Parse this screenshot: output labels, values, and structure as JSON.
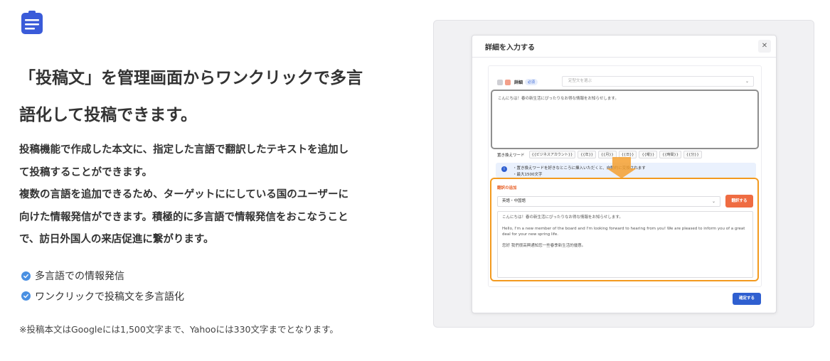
{
  "heading": {
    "line1": "「投稿文」を管理画面からワンクリックで多言",
    "line2": "語化して投稿できます。"
  },
  "description": {
    "line1": "投稿機能で作成した本文に、指定した言語で翻訳したテキストを追加し",
    "line2": "て投稿することができます。",
    "line3": "複数の言語を追加できるため、ターゲットににしている国のユーザーに",
    "line4": "向けた情報発信ができます。積極的に多言語で情報発信をおこなうこと",
    "line5": "で、訪日外国人の来店促進に繋がります。"
  },
  "bullets": [
    "多言語での情報発信",
    "ワンクリックで投稿文を多言語化"
  ],
  "note": "※投稿本文はGoogleには1,500文字まで、Yahooには330文字までとなります。",
  "colors": {
    "accent_blue": "#2f5fd0",
    "check_blue": "#4a90e2",
    "highlight_orange": "#f39a1f",
    "translate_button": "#ef6c42"
  },
  "icons": {
    "feature": "document-lines-icon",
    "bullet": "check-circle-icon",
    "close": "close-icon",
    "info": "info-icon"
  },
  "modal": {
    "title": "詳細を入力する",
    "detail_label": "詳細",
    "required_badge": "必須",
    "template_placeholder": "定型文を選ぶ",
    "body_text": "こんにちは！春の新生活にぴったりなお得な情報をお知らせします。",
    "replace_label": "置き換えワード",
    "replace_chips": [
      "{{ビジネスアカウント}}",
      "{{年}}",
      "{{月}}",
      "{{日}}",
      "{{曜}}",
      "{{時間}}",
      "{{分}}"
    ],
    "info_line1": "・置き換えワードを好きなところに挿入いただくと、自動的に変換されます",
    "info_line2": "・最大1500文字",
    "translation": {
      "title": "翻訳の追加",
      "language": "英語・中国語",
      "translate_button": "翻訳する",
      "text_ja": "こんにちは！春の新生活にぴったりなお得な情報をお知らせします。",
      "text_en": "Hello, I'm a new member of the board and I'm looking forward to hearing from you! We are pleased to inform you of a great deal for your new spring life.",
      "text_zh": "您好 我們很高興通知您一些春季新生活的優惠。"
    },
    "confirm_button": "確定する"
  }
}
